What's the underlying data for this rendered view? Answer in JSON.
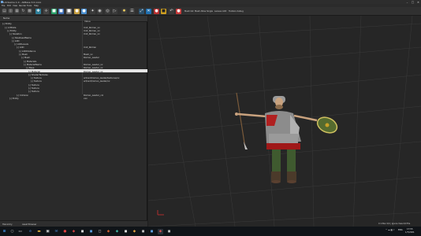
{
  "window": {
    "title": "LotrGame 1.0 - AllBase 3.0.xxxx",
    "minimize": "–",
    "maximize": "□",
    "close": "✕"
  },
  "menu": [
    "File",
    "Edit",
    "View",
    "Render",
    "Tools",
    "Help"
  ],
  "toolbar": {
    "items": [
      "Mesh list",
      "Mesh Atlas",
      "Single",
      "Leaves",
      "LOD",
      "Toolbox debug"
    ]
  },
  "hierarchy": {
    "col_name": "Name",
    "col_value": "Value",
    "rows": [
      {
        "name": "[-] Entity",
        "value": "",
        "indent": 0,
        "selected": false
      },
      {
        "name": "[-] ArtData",
        "value": "Unit_Roman_xx",
        "indent": 1,
        "selected": false
      },
      {
        "name": "[-] Entity",
        "value": "Unit_Roman_xx",
        "indent": 2,
        "selected": false
      },
      {
        "name": "[-] Skeleton",
        "value": "Unit_Roman_xx",
        "indent": 3,
        "selected": false
      },
      {
        "name": "[-] SkelAssetName",
        "value": "",
        "indent": 4,
        "selected": false
      },
      {
        "name": "[-] LOD",
        "value": "",
        "indent": 4,
        "selected": false
      },
      {
        "name": "[-] LODLevels",
        "value": "",
        "indent": 5,
        "selected": false
      },
      {
        "name": "[-] LOD",
        "value": "Unit_Roman",
        "indent": 6,
        "selected": false
      },
      {
        "name": "[-] LODDistance",
        "value": "",
        "indent": 7,
        "selected": false
      },
      {
        "name": "[-] Mesh",
        "value": "Mesh_xx",
        "indent": 7,
        "selected": false
      },
      {
        "name": "[-] Mesh",
        "value": "Roman_Leader",
        "indent": 8,
        "selected": false
      },
      {
        "name": "[-] Materials",
        "value": "",
        "indent": 9,
        "selected": false
      },
      {
        "name": "[-] MaterialName",
        "value": "Roman_Leader_xx",
        "indent": 9,
        "selected": false
      },
      {
        "name": "[-] Base",
        "value": "Roman_Leader_xx",
        "indent": 10,
        "selected": false
      },
      {
        "name": "[-] Material",
        "value": "Roman_Leader_xx",
        "indent": 11,
        "selected": true
      },
      {
        "name": "[-] ShaderTextures",
        "value": "",
        "indent": 11,
        "selected": false
      },
      {
        "name": "[-] Texture",
        "value": "art/unit/roman_leader/textures/xx",
        "indent": 12,
        "selected": false
      },
      {
        "name": "[-] Texture",
        "value": "art/unit/roman_leader/xx",
        "indent": 12,
        "selected": false
      },
      {
        "name": "[-] Texture",
        "value": "",
        "indent": 11,
        "selected": false
      },
      {
        "name": "[-] Texture",
        "value": "",
        "indent": 11,
        "selected": false
      },
      {
        "name": "[-] Texture",
        "value": "",
        "indent": 11,
        "selected": false
      },
      {
        "name": "[-] Collision",
        "value": "Roman_Leader_col",
        "indent": 6,
        "selected": false
      },
      {
        "name": "[-] Entity",
        "value": "xxx",
        "indent": 3,
        "selected": false
      }
    ],
    "footer_tabs": [
      "Hierarchy",
      "Asset Browser"
    ]
  },
  "viewport": {
    "stats": "0 1 Misc 0/0 | Ignore View 0/0 File"
  },
  "taskbar": {
    "tray_lang": "ENG",
    "tray_time": "17:55",
    "tray_date": "1/7/2021",
    "tray_icons": "^ ☁ ▦ ♪"
  }
}
